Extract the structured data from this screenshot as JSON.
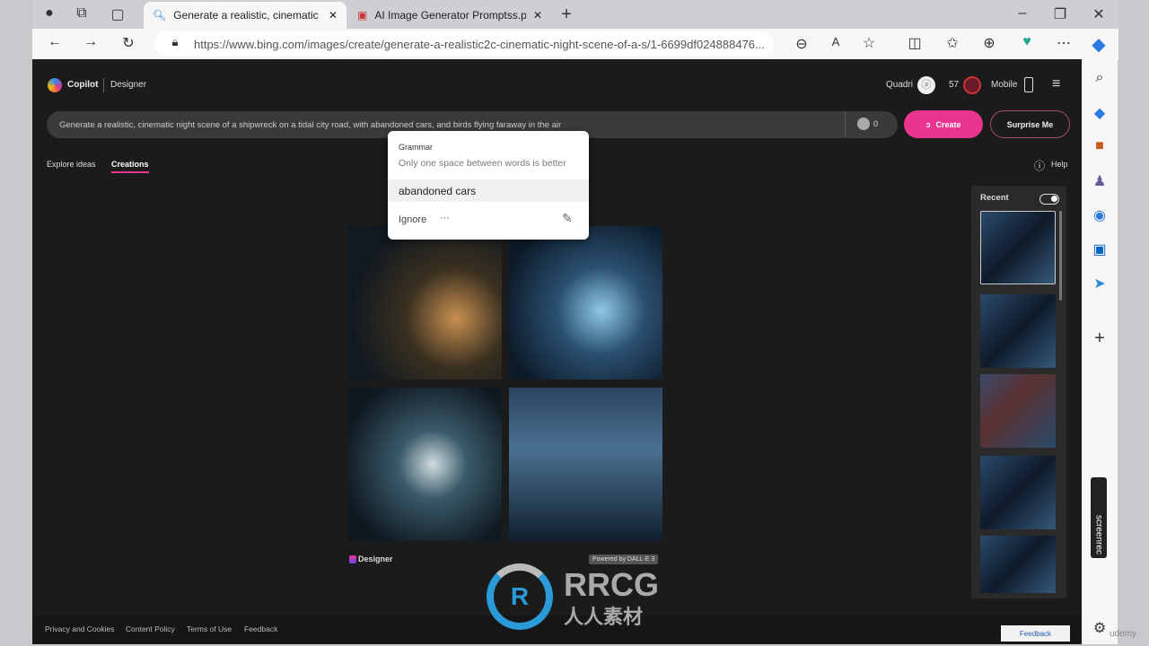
{
  "browser": {
    "tabs": [
      {
        "title": "Generate a realistic, cinematic nic",
        "icon": "search-icon"
      },
      {
        "title": "AI Image Generator Promptss.pd",
        "icon": "pdf-icon"
      }
    ],
    "url": "https://www.bing.com/images/create/generate-a-realistic2c-cinematic-night-scene-of-a-s/1-6699df024888476..."
  },
  "header": {
    "brand": "Copilot",
    "product": "Designer",
    "user": "Quadri",
    "coins": "57",
    "mobile": "Mobile"
  },
  "prompt": {
    "text": "Generate a realistic, cinematic night scene of a shipwreck on a tidal city road, with abandoned  cars, and birds flying faraway in the air",
    "boosts": "0",
    "create": "Create",
    "surprise": "Surprise Me"
  },
  "tabs": {
    "explore": "Explore ideas",
    "creations": "Creations",
    "help": "Help"
  },
  "grammar": {
    "title": "Grammar",
    "message": "Only one space between words is better",
    "suggestion": "abandoned cars",
    "ignore": "Ignore",
    "more": "···"
  },
  "recent": {
    "label": "Recent",
    "toggle_on": true
  },
  "result": {
    "designer": "Designer",
    "powered": "Powered by DALL·E 3"
  },
  "footer": {
    "links": [
      "Privacy and Cookies",
      "Content Policy",
      "Terms of Use",
      "Feedback"
    ],
    "feedback_btn": "Feedback"
  },
  "watermark": {
    "text": "RRCG",
    "sub": "人人素材"
  },
  "overlay": {
    "screenrec": "screenrec",
    "udemy": "udemy"
  },
  "colors": {
    "accent": "#e9358e",
    "bg": "#1b1b1b"
  }
}
